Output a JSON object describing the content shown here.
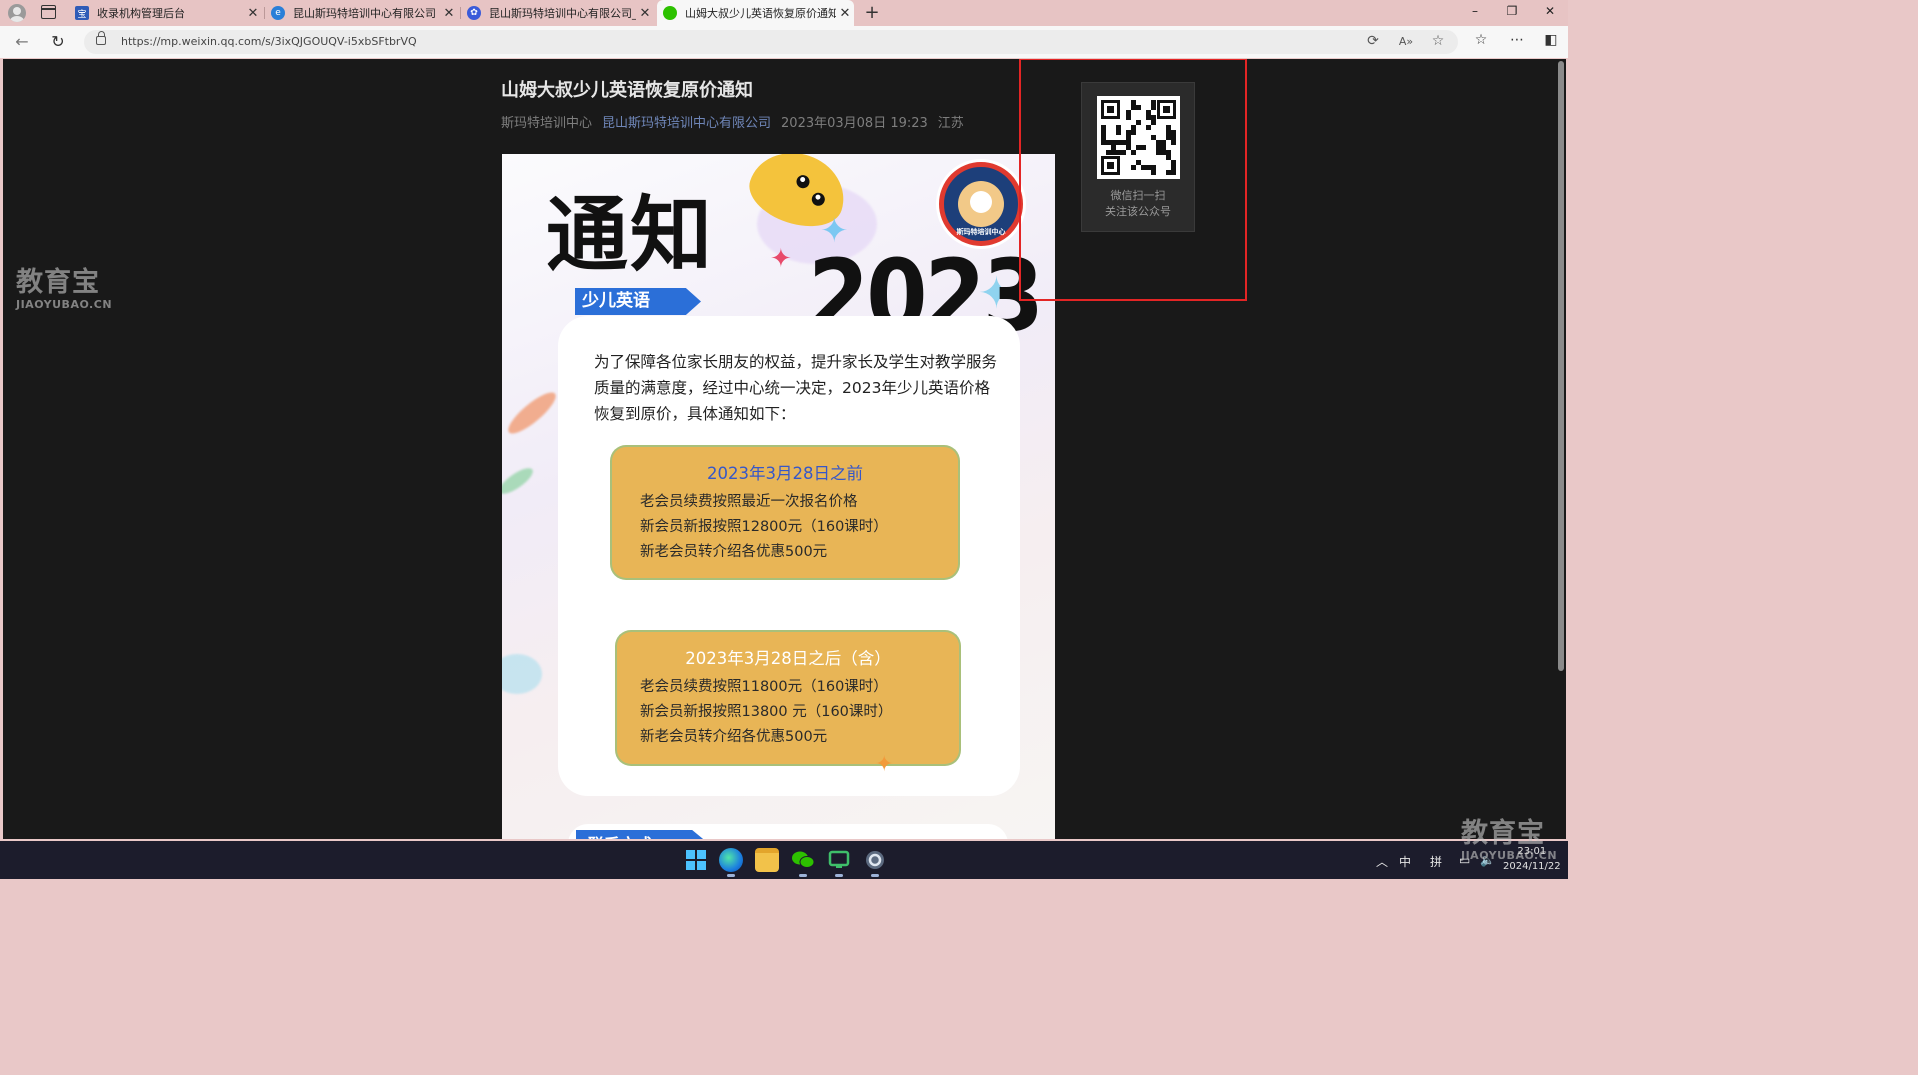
{
  "browser": {
    "tabs": [
      {
        "title": "收录机构管理后台",
        "favicon": "admin-favicon",
        "active": false
      },
      {
        "title": "昆山斯玛特培训中心有限公司 - 天",
        "favicon": "edge-favicon",
        "active": false
      },
      {
        "title": "昆山斯玛特培训中心有限公司_百度",
        "favicon": "baidu-favicon",
        "active": false
      },
      {
        "title": "山姆大叔少儿英语恢复原价通知",
        "favicon": "wechat-favicon",
        "active": true
      }
    ],
    "new_tab_label": "+",
    "window_controls": {
      "minimize": "–",
      "restore": "❐",
      "close": "✕"
    },
    "url": "https://mp.weixin.qq.com/s/3ixQJGOUQV-i5xbSFtbrVQ",
    "read_aloud": "A»",
    "toolbar_icons": [
      "favorites-star-icon",
      "collections-icon",
      "more-icon",
      "sidebar-icon"
    ]
  },
  "article": {
    "title": "山姆大叔少儿英语恢复原价通知",
    "author": "斯玛特培训中心",
    "account": "昆山斯玛特培训中心有限公司",
    "datetime": "2023年03月08日 19:23",
    "location": "江苏"
  },
  "poster": {
    "headline": "通知",
    "year": "2023",
    "logo_text": "斯玛特培训中心",
    "category": "少儿英语",
    "intro": "为了保障各位家长朋友的权益，提升家长及学生对教学服务质量的满意度，经过中心统一决定，2023年少儿英语价格恢复到原价，具体通知如下：",
    "before": {
      "heading": "2023年3月28日之前",
      "lines": [
        "老会员续费按照最近一次报名价格",
        "新会员新报按照12800元（160课时）",
        "新老会员转介绍各优惠500元"
      ]
    },
    "after": {
      "heading": "2023年3月28日之后（含）",
      "lines": [
        "老会员续费按照11800元（160课时）",
        "新会员新报按照13800 元（160课时）",
        "新老会员转介绍各优惠500元"
      ]
    },
    "next_section": "联系方式"
  },
  "qr_panel": {
    "line1": "微信扫一扫",
    "line2": "关注该公众号"
  },
  "watermark": {
    "cn": "教育宝",
    "en": "JIAOYUBAO.CN"
  },
  "taskbar": {
    "apps": [
      "windows-start-icon",
      "edge-icon",
      "file-explorer-icon",
      "wechat-icon",
      "remote-desktop-icon",
      "settings-icon"
    ],
    "ime_lang": "中",
    "ime_mode": "拼",
    "time": "23:01",
    "date": "2024/11/22"
  },
  "colors": {
    "accent_red": "#e32525",
    "poster_blue": "#2b6fd8",
    "poster_gold": "#e8b556",
    "link": "#6f86b8"
  }
}
